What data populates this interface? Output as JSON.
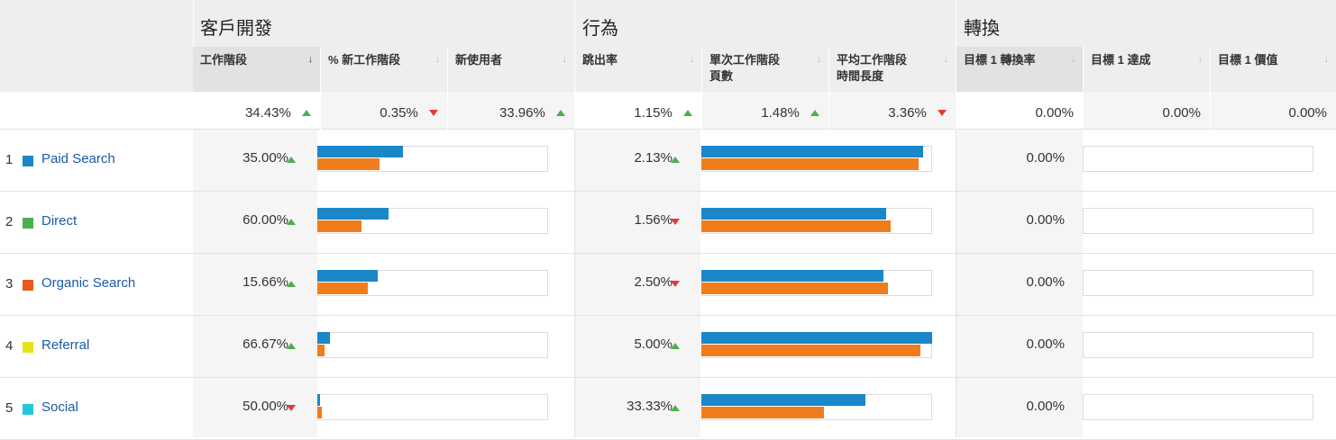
{
  "groups": {
    "acquisition": "客戶開發",
    "behavior": "行為",
    "conversions": "轉換"
  },
  "columns": {
    "sessions": "工作階段",
    "pct_new_sessions": "% 新工作階段",
    "new_users": "新使用者",
    "bounce_rate": "跳出率",
    "pages_per_session_l1": "單次工作階段",
    "pages_per_session_l2": "頁數",
    "avg_duration_l1": "平均工作階段",
    "avg_duration_l2": "時間長度",
    "goal_conv_rate": "目標 1 轉換率",
    "goal_completions": "目標 1 達成",
    "goal_value": "目標 1 價值"
  },
  "totals": {
    "sessions": "34.43%",
    "sessions_trend": "up",
    "pct_new_sessions": "0.35%",
    "pct_new_sessions_trend": "down",
    "new_users": "33.96%",
    "new_users_trend": "up",
    "bounce_rate": "1.15%",
    "bounce_rate_trend": "up",
    "pages_per_session": "1.48%",
    "pages_per_session_trend": "up",
    "avg_duration": "3.36%",
    "avg_duration_trend": "down",
    "goal_conv_rate": "0.00%",
    "goal_completions": "0.00%",
    "goal_value": "0.00%"
  },
  "rows": [
    {
      "num": "1",
      "channel": "Paid Search",
      "color": "#1a87c8",
      "sessions": "35.00%",
      "sessions_trend": "up",
      "bar_acq": {
        "blue": 0.37,
        "orange": 0.27
      },
      "bounce": "2.13%",
      "bounce_trend": "up",
      "bar_beh": {
        "blue": 0.96,
        "orange": 0.94
      },
      "goal": "0.00%"
    },
    {
      "num": "2",
      "channel": "Direct",
      "color": "#4caf50",
      "sessions": "60.00%",
      "sessions_trend": "up",
      "bar_acq": {
        "blue": 0.31,
        "orange": 0.19
      },
      "bounce": "1.56%",
      "bounce_trend": "down",
      "bar_beh": {
        "blue": 0.8,
        "orange": 0.82
      },
      "goal": "0.00%"
    },
    {
      "num": "3",
      "channel": "Organic Search",
      "color": "#e8591a",
      "sessions": "15.66%",
      "sessions_trend": "up",
      "bar_acq": {
        "blue": 0.26,
        "orange": 0.22
      },
      "bounce": "2.50%",
      "bounce_trend": "down",
      "bar_beh": {
        "blue": 0.79,
        "orange": 0.81
      },
      "goal": "0.00%"
    },
    {
      "num": "4",
      "channel": "Referral",
      "color": "#e8e21a",
      "sessions": "66.67%",
      "sessions_trend": "up",
      "bar_acq": {
        "blue": 0.055,
        "orange": 0.03
      },
      "bounce": "5.00%",
      "bounce_trend": "up",
      "bar_beh": {
        "blue": 1.0,
        "orange": 0.95
      },
      "goal": "0.00%"
    },
    {
      "num": "5",
      "channel": "Social",
      "color": "#26c6da",
      "sessions": "50.00%",
      "sessions_trend": "down",
      "bar_acq": {
        "blue": 0.012,
        "orange": 0.018
      },
      "bounce": "33.33%",
      "bounce_trend": "up",
      "bar_beh": {
        "blue": 0.71,
        "orange": 0.53
      },
      "goal": "0.00%"
    }
  ]
}
